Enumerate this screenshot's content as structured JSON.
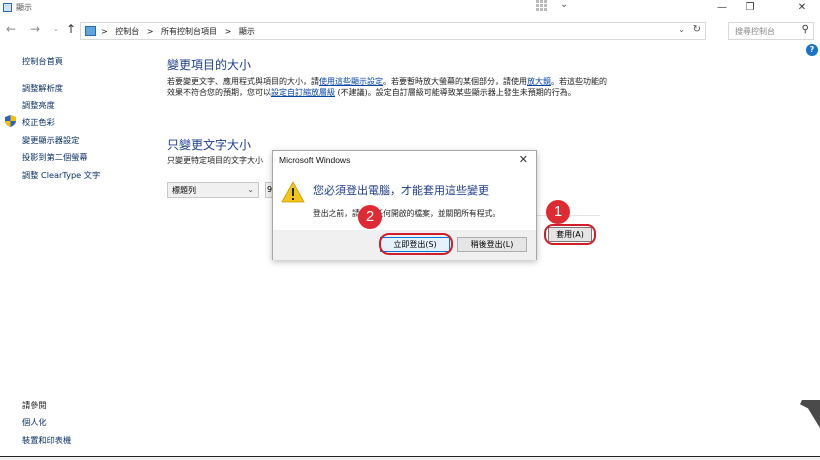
{
  "window": {
    "title": "顯示"
  },
  "nav": {
    "back": "←",
    "forward": "→",
    "recent": "⌄",
    "up": "↑",
    "breadcrumbs": [
      ">",
      "控制台",
      ">",
      "所有控制台項目",
      ">",
      "顯示"
    ],
    "dropdown": "⌄",
    "refresh": "↻",
    "search_placeholder": "搜尋控制台"
  },
  "sidebar": {
    "home": "控制台首頁",
    "items": [
      "調整解析度",
      "調整亮度",
      "校正色彩",
      "變更顯示器設定",
      "投影到第二個螢幕",
      "調整 ClearType 文字"
    ],
    "see_also": "請參閱",
    "see_also_items": [
      "個人化",
      "裝置和印表機"
    ]
  },
  "main": {
    "heading1": "變更項目的大小",
    "para1_a": "若要變更文字、應用程式與項目的大小，請",
    "para1_link1": "使用這些顯示設定",
    "para1_b": "。若要暫時放大螢幕的某個部分，請使用",
    "para1_link2": "放大鏡",
    "para1_c": "。若這些功能的效果不符合您的預期，您可以",
    "para1_link3": "設定自訂縮放層級",
    "para1_d": " (不建議)。設定自訂層級可能導致某些顯示器上發生未預期的行為。",
    "heading2": "只變更文字大小",
    "para2": "只變更特定項目的文字大小",
    "element_select": "標題列",
    "size_select": "9",
    "apply_button": "套用(A)"
  },
  "dialog": {
    "title": "Microsoft Windows",
    "close": "✕",
    "main_instruction": "您必須登出電腦，才能套用這些變更",
    "description": "登出之前，請儲存任何開啟的檔案，並關閉所有程式。",
    "signout_now": "立即登出(S)",
    "signout_later": "稍後登出(L)"
  },
  "annotations": {
    "marker1": "1",
    "marker2": "2",
    "color": "#de2a32"
  },
  "help": "?"
}
